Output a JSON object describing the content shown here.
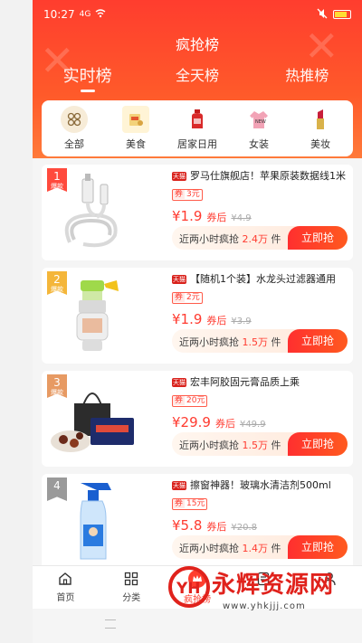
{
  "status": {
    "time": "10:27",
    "signal": "4G",
    "battery": "battery"
  },
  "header": {
    "title": "疯抢榜"
  },
  "tabs": [
    {
      "label": "实时榜",
      "active": true
    },
    {
      "label": "全天榜",
      "active": false
    },
    {
      "label": "热推榜",
      "active": false
    }
  ],
  "categories": [
    {
      "label": "全部",
      "icon": "grid-icon"
    },
    {
      "label": "美食",
      "icon": "food-icon"
    },
    {
      "label": "居家日用",
      "icon": "bottle-icon"
    },
    {
      "label": "女装",
      "icon": "dress-icon"
    },
    {
      "label": "美妆",
      "icon": "lipstick-icon"
    }
  ],
  "items": [
    {
      "rank": "1",
      "rank_sub": "爆款",
      "shop_tag": "天猫",
      "name": "罗马仕旗舰店！苹果原装数据线1米",
      "coupon_label": "券",
      "coupon_value": "3元",
      "price": "¥1.9",
      "after_label": "券后",
      "orig_price": "¥4.9",
      "sold_prefix": "近两小时疯抢",
      "sold_value": "2.4万",
      "sold_suffix": "件",
      "buy_label": "立即抢"
    },
    {
      "rank": "2",
      "rank_sub": "爆款",
      "shop_tag": "天猫",
      "name": "【随机1个装】水龙头过滤器通用",
      "coupon_label": "券",
      "coupon_value": "2元",
      "price": "¥1.9",
      "after_label": "券后",
      "orig_price": "¥3.9",
      "sold_prefix": "近两小时疯抢",
      "sold_value": "1.5万",
      "sold_suffix": "件",
      "buy_label": "立即抢"
    },
    {
      "rank": "3",
      "rank_sub": "爆款",
      "shop_tag": "天猫",
      "name": "宏丰阿胶固元膏品质上乘",
      "coupon_label": "券",
      "coupon_value": "20元",
      "price": "¥29.9",
      "after_label": "券后",
      "orig_price": "¥49.9",
      "sold_prefix": "近两小时疯抢",
      "sold_value": "1.5万",
      "sold_suffix": "件",
      "buy_label": "立即抢"
    },
    {
      "rank": "4",
      "rank_sub": "",
      "shop_tag": "天猫",
      "name": "擦窗神器！玻璃水清洁剂500ml",
      "coupon_label": "券",
      "coupon_value": "15元",
      "price": "¥5.8",
      "after_label": "券后",
      "orig_price": "¥20.8",
      "sold_prefix": "近两小时疯抢",
      "sold_value": "1.4万",
      "sold_suffix": "件",
      "buy_label": "立即抢"
    }
  ],
  "nav": [
    {
      "label": "首页",
      "icon": "home-icon"
    },
    {
      "label": "分类",
      "icon": "category-icon"
    },
    {
      "label": "疯抢榜",
      "icon": "crown-icon"
    },
    {
      "label": "",
      "icon": "document-icon"
    },
    {
      "label": "",
      "icon": "user-icon"
    }
  ],
  "watermark": {
    "logo": "YH",
    "text": "永辉资源网",
    "url": "www.yhkjjj.com"
  },
  "colors": {
    "brand": "#ff3d2e",
    "price": "#ff3b30"
  }
}
